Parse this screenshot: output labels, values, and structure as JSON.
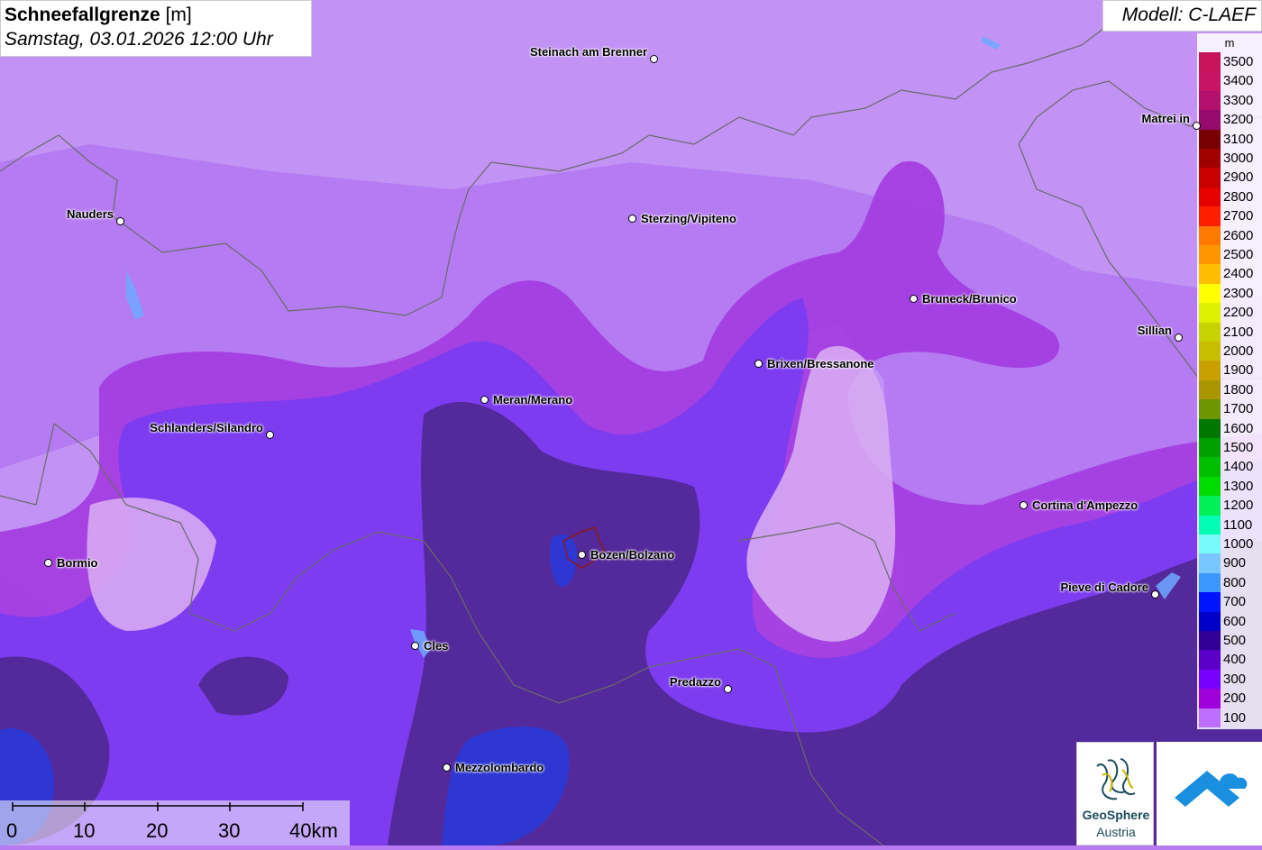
{
  "title": {
    "main_bold": "Schneefallgrenze",
    "main_unit": "[m]",
    "subtitle": "Samstag, 03.01.2026 12:00 Uhr"
  },
  "model": "Modell: C-LAEF",
  "legend": {
    "unit": "m",
    "items": [
      {
        "value": "3500",
        "color": "#c8145a"
      },
      {
        "value": "3400",
        "color": "#c81464"
      },
      {
        "value": "3300",
        "color": "#b4106e"
      },
      {
        "value": "3200",
        "color": "#960a6e"
      },
      {
        "value": "3100",
        "color": "#780000"
      },
      {
        "value": "3000",
        "color": "#a00000"
      },
      {
        "value": "2900",
        "color": "#c80000"
      },
      {
        "value": "2800",
        "color": "#e60000"
      },
      {
        "value": "2700",
        "color": "#ff1e00"
      },
      {
        "value": "2600",
        "color": "#ff7800"
      },
      {
        "value": "2500",
        "color": "#ff9600"
      },
      {
        "value": "2400",
        "color": "#ffbe00"
      },
      {
        "value": "2300",
        "color": "#ffff00"
      },
      {
        "value": "2200",
        "color": "#dcf000"
      },
      {
        "value": "2100",
        "color": "#c8d200"
      },
      {
        "value": "2000",
        "color": "#c8be00"
      },
      {
        "value": "1900",
        "color": "#c8a000"
      },
      {
        "value": "1800",
        "color": "#aa9600"
      },
      {
        "value": "1700",
        "color": "#6e9600"
      },
      {
        "value": "1600",
        "color": "#007800"
      },
      {
        "value": "1500",
        "color": "#00a000"
      },
      {
        "value": "1400",
        "color": "#00be00"
      },
      {
        "value": "1300",
        "color": "#00dc00"
      },
      {
        "value": "1200",
        "color": "#00f05a"
      },
      {
        "value": "1100",
        "color": "#00ffb4"
      },
      {
        "value": "1000",
        "color": "#78fafa"
      },
      {
        "value": "900",
        "color": "#78c8ff"
      },
      {
        "value": "800",
        "color": "#3c96ff"
      },
      {
        "value": "700",
        "color": "#0014ff"
      },
      {
        "value": "600",
        "color": "#0000c8"
      },
      {
        "value": "500",
        "color": "#320096"
      },
      {
        "value": "400",
        "color": "#5a00c8"
      },
      {
        "value": "300",
        "color": "#7800ff"
      },
      {
        "value": "200",
        "color": "#a000dc"
      },
      {
        "value": "100",
        "color": "#be6eff"
      }
    ]
  },
  "cities": [
    {
      "name": "Steinach am Brenner",
      "side": "left"
    },
    {
      "name": "Nauders",
      "side": "left"
    },
    {
      "name": "Sterzing/Vipiteno",
      "side": "right"
    },
    {
      "name": "Matrei in",
      "side": "left"
    },
    {
      "name": "Bruneck/Brunico",
      "side": "right"
    },
    {
      "name": "Sillian",
      "side": "left"
    },
    {
      "name": "Brixen/Bressanone",
      "side": "right"
    },
    {
      "name": "Meran/Merano",
      "side": "right"
    },
    {
      "name": "Schlanders/Silandro",
      "side": "left"
    },
    {
      "name": "Cortina d'Ampezzo",
      "side": "right"
    },
    {
      "name": "Bormio",
      "side": "right"
    },
    {
      "name": "Bozen/Bolzano",
      "side": "right"
    },
    {
      "name": "Pieve di Cadore",
      "side": "left"
    },
    {
      "name": "Cles",
      "side": "right"
    },
    {
      "name": "Predazzo",
      "side": "left"
    },
    {
      "name": "Mezzolombardo",
      "side": "right"
    }
  ],
  "scale": {
    "labels": [
      "0",
      "10",
      "20",
      "30",
      "40km"
    ]
  },
  "logos": {
    "geosphere_line1": "GeoSphere",
    "geosphere_line2": "Austria"
  }
}
